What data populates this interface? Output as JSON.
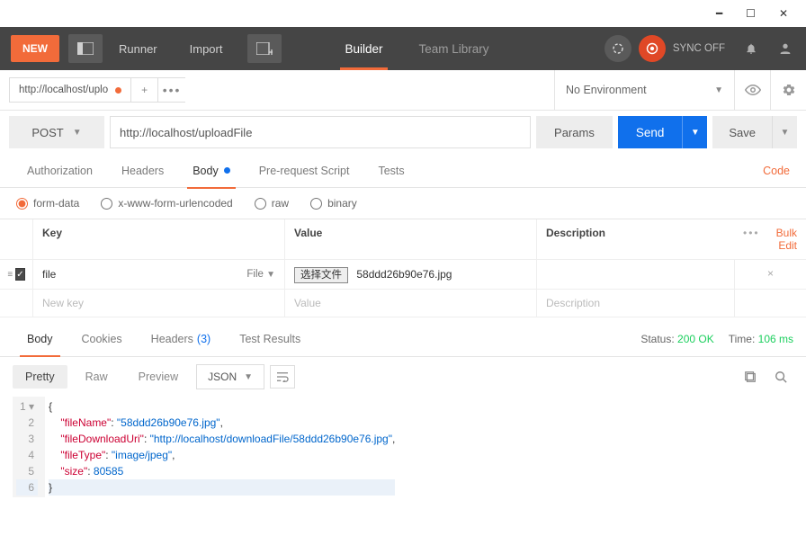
{
  "window": {
    "title_tab": "http://localhost/uplo"
  },
  "toolbar": {
    "new": "NEW",
    "runner": "Runner",
    "import": "Import",
    "builder": "Builder",
    "team_library": "Team Library",
    "sync": "SYNC OFF"
  },
  "env": {
    "selected": "No Environment"
  },
  "request": {
    "method": "POST",
    "url": "http://localhost/uploadFile",
    "params_btn": "Params",
    "send_btn": "Send",
    "save_btn": "Save",
    "tabs": {
      "authorization": "Authorization",
      "headers": "Headers",
      "body": "Body",
      "prerequest": "Pre-request Script",
      "tests": "Tests"
    },
    "code_link": "Code",
    "body_types": {
      "form_data": "form-data",
      "urlencoded": "x-www-form-urlencoded",
      "raw": "raw",
      "binary": "binary"
    },
    "kv": {
      "head": {
        "key": "Key",
        "value": "Value",
        "description": "Description"
      },
      "bulk_edit": "Bulk Edit",
      "row": {
        "key": "file",
        "type": "File",
        "choose_btn": "选择文件",
        "filename": "58ddd26b90e76.jpg"
      },
      "placeholders": {
        "key": "New key",
        "value": "Value",
        "description": "Description"
      }
    }
  },
  "response": {
    "tabs": {
      "body": "Body",
      "cookies": "Cookies",
      "headers": "Headers",
      "headers_count": "(3)",
      "tests": "Test Results"
    },
    "status_label": "Status:",
    "status_value": "200 OK",
    "time_label": "Time:",
    "time_value": "106 ms",
    "viewer": {
      "pretty": "Pretty",
      "raw": "Raw",
      "preview": "Preview",
      "format": "JSON"
    },
    "json_text": "{\n    \"fileName\": \"58ddd26b90e76.jpg\",\n    \"fileDownloadUri\": \"http://localhost/downloadFile/58ddd26b90e76.jpg\",\n    \"fileType\": \"image/jpeg\",\n    \"size\": 80585\n}",
    "json": {
      "keys": [
        "fileName",
        "fileDownloadUri",
        "fileType",
        "size"
      ],
      "vals": {
        "fileName": "\"58ddd26b90e76.jpg\"",
        "fileDownloadUri": "\"http://localhost/downloadFile/58ddd26b90e76.jpg\"",
        "fileType": "\"image/jpeg\"",
        "size": "80585"
      }
    }
  }
}
